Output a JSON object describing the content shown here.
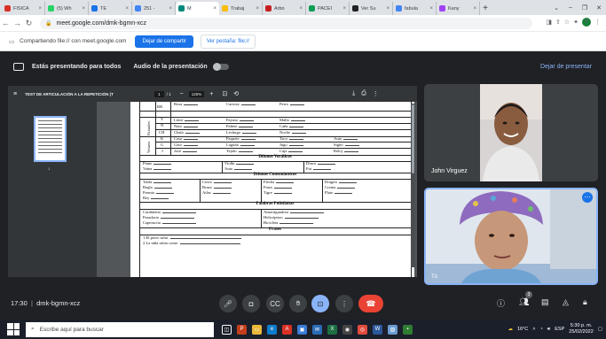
{
  "tabs": [
    {
      "label": "FISICA",
      "color": "#d93025"
    },
    {
      "label": "(5) Wh",
      "color": "#25d366"
    },
    {
      "label": "TE",
      "color": "#1a73e8"
    },
    {
      "label": "251 -",
      "color": "#4285f4"
    },
    {
      "label": "M",
      "color": "#00897b",
      "active": true
    },
    {
      "label": "Trabaj",
      "color": "#fbbc04"
    },
    {
      "label": "Árbo",
      "color": "#c5221f"
    },
    {
      "label": "PACEI",
      "color": "#0f9d58"
    },
    {
      "label": "Ver Su",
      "color": "#202124"
    },
    {
      "label": "fabula",
      "color": "#4285f4"
    },
    {
      "label": "Kany",
      "color": "#a142f4"
    }
  ],
  "new_tab": "+",
  "address": {
    "url": "meet.google.com/dmk-bgmn-xcz",
    "profile": "T"
  },
  "sharebar": {
    "text": "Compartiendo file:// con meet.google.com",
    "stop": "Dejar de compartir",
    "switch": "Ver pestaña: file://"
  },
  "presenting": {
    "text": "Estás presentando para todos",
    "audio": "Audio de la presentación",
    "stop": "Dejar de presentar"
  },
  "pdf": {
    "title": "TEST DE ARTICULACIÓN A LA REPETICIÓN (T",
    "page": "1",
    "pages": "/ 1",
    "zoom": "125%",
    "thumb_num": "1"
  },
  "doc": {
    "r1": {
      "label": "RR",
      "c1": "Rosa",
      "c2": "Carroza",
      "c3": "Perro"
    },
    "g1": {
      "phon": "Palatales",
      "rows": [
        {
          "label": "Y",
          "c1": "Llave",
          "c2": "Payaso",
          "c3": "Malla"
        },
        {
          "label": "Ñ",
          "c1": "Nato",
          "c2": "Pañete",
          "c3": "Caña"
        },
        {
          "label": "CH",
          "c1": "Chala",
          "c2": "Lechuga",
          "c3": "Noche"
        }
      ]
    },
    "g2": {
      "phon": "Velares",
      "rows": [
        {
          "label": "K",
          "c1": "Casa",
          "c2": "Paquete",
          "c3": "Taco",
          "c4": "Auto"
        },
        {
          "label": "G",
          "c1": "Gato",
          "c2": "Laguna",
          "c3": "Jugo",
          "c4": "Signo"
        },
        {
          "label": "J",
          "c1": "José",
          "c2": "Tejido",
          "c3": "Caja",
          "c4": "Reloj"
        }
      ]
    },
    "s1": {
      "title": "Difonos Vocálicos",
      "w": [
        "Piano",
        "Vaina",
        "Violín",
        "Auto",
        "Dinca",
        "Fui"
      ]
    },
    "s2": {
      "title": "Difonos Consonánticos",
      "w": [
        "Tabla",
        "Regla",
        "Premio",
        "Rey",
        "Cinco",
        "Brazo",
        "Atlas",
        "Flecha",
        "Fruta",
        "Tigre",
        "Dragón",
        "Crema",
        "Plato"
      ]
    },
    "s3": {
      "title": "Palabras Polisílabas",
      "w": [
        "Carabinero",
        "Pasadorio",
        "Caperucita",
        "Amortiguadora",
        "Helicóptero",
        "Bicicleta"
      ]
    },
    "s4": {
      "title": "Frases",
      "f1": "1.El perro salta.",
      "f2": "2.La niña rubia come."
    }
  },
  "participant": {
    "name": "John Virguez"
  },
  "self": {
    "name": "Tú"
  },
  "meeting": {
    "time": "17:30",
    "sep": "|",
    "code": "dmk-bgmn-xcz",
    "participants": "3"
  },
  "taskbar": {
    "search": "Escribe aquí para buscar",
    "temp": "16°C",
    "lang": "ESP",
    "time": "5:30 p. m.",
    "date": "25/02/2022"
  },
  "colors": {
    "accent": "#1a73e8",
    "end": "#ea4335"
  }
}
